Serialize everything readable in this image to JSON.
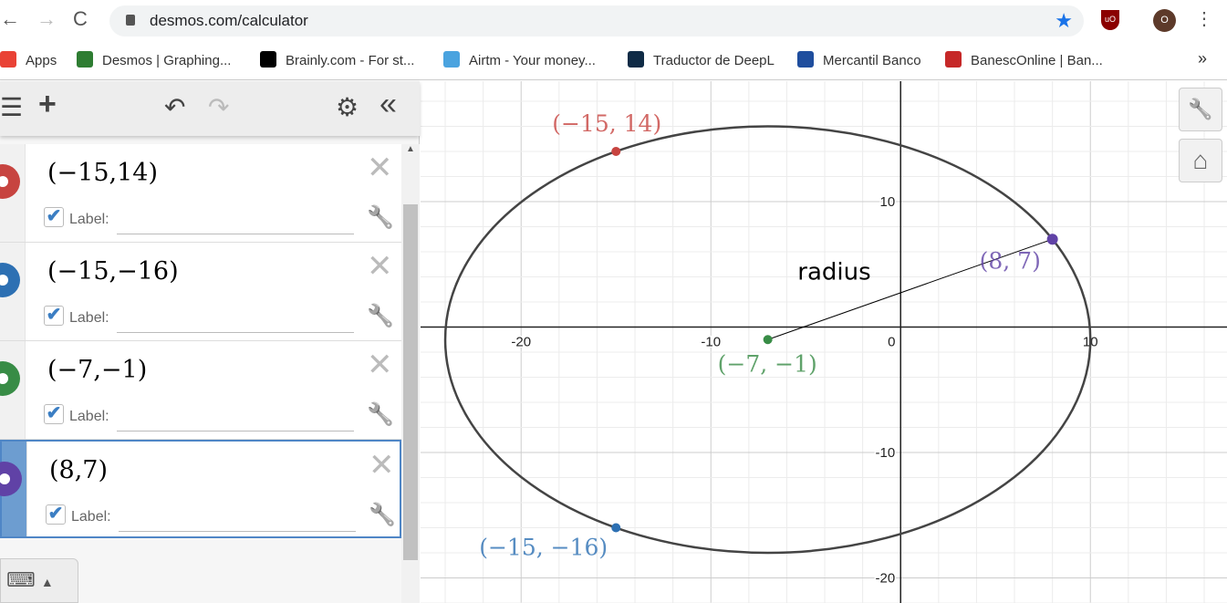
{
  "browser": {
    "url": "desmos.com/calculator",
    "back": "←",
    "forward": "→",
    "reload": "C",
    "avatar": "O",
    "ext": "uO",
    "menu": "⋮",
    "bookmarks": [
      {
        "label": "Apps",
        "color": "#e94235"
      },
      {
        "label": "Desmos | Graphing...",
        "color": "#2e7d32"
      },
      {
        "label": "Brainly.com - For st...",
        "color": "#000000"
      },
      {
        "label": "Airtm - Your money...",
        "color": "#4aa3df"
      },
      {
        "label": "Traductor de DeepL",
        "color": "#0f2b46"
      },
      {
        "label": "Mercantil Banco",
        "color": "#1f4e9e"
      },
      {
        "label": "BanescOnline | Ban...",
        "color": "#c62828"
      }
    ],
    "more": "»"
  },
  "toolbar": {
    "menu": "☰",
    "add": "+",
    "undo": "↶",
    "redo": "↷",
    "settings": "⚙",
    "collapse": "«"
  },
  "expressions": [
    {
      "latex": "(−15,14)",
      "color": "#c74440",
      "label_text": "Label:",
      "label_value": "",
      "checked": true
    },
    {
      "latex": "(−15,−16)",
      "color": "#2d70b3",
      "label_text": "Label:",
      "label_value": "",
      "checked": true
    },
    {
      "latex": "(−7,−1)",
      "color": "#388c46",
      "label_text": "Label:",
      "label_value": "",
      "checked": true
    },
    {
      "latex": "(8,7)",
      "color": "#6042a6",
      "label_text": "Label:",
      "label_value": "",
      "checked": true
    }
  ],
  "graph_buttons": {
    "wrench": "🔧",
    "home": "⌂"
  },
  "chart_data": {
    "type": "scatter",
    "xlim": [
      -25.3,
      17.2
    ],
    "ylim": [
      -22,
      19.6
    ],
    "x_ticks": [
      -20,
      -10,
      0,
      10
    ],
    "y_ticks": [
      10,
      -10,
      -20
    ],
    "tick_labels": {
      "x": [
        "-20",
        "-10",
        "0",
        "10"
      ],
      "y": [
        "10",
        "-10",
        "-20"
      ]
    },
    "grid": true,
    "minor_step": 2,
    "points": [
      {
        "x": -15,
        "y": 14,
        "label": "(−15, 14)",
        "color": "#c74440"
      },
      {
        "x": -15,
        "y": -16,
        "label": "(−15, −16)",
        "color": "#2d70b3"
      },
      {
        "x": -7,
        "y": -1,
        "label": "(−7, −1)",
        "color": "#388c46"
      },
      {
        "x": 8,
        "y": 7,
        "label": "(8, 7)",
        "color": "#6042a6"
      }
    ],
    "circle": {
      "cx": -7,
      "cy": -1,
      "r": 17
    },
    "segment": {
      "from": [
        -7,
        -1
      ],
      "to": [
        8,
        7
      ],
      "label": "radius",
      "label_pos": [
        -3.5,
        3.8
      ]
    }
  }
}
